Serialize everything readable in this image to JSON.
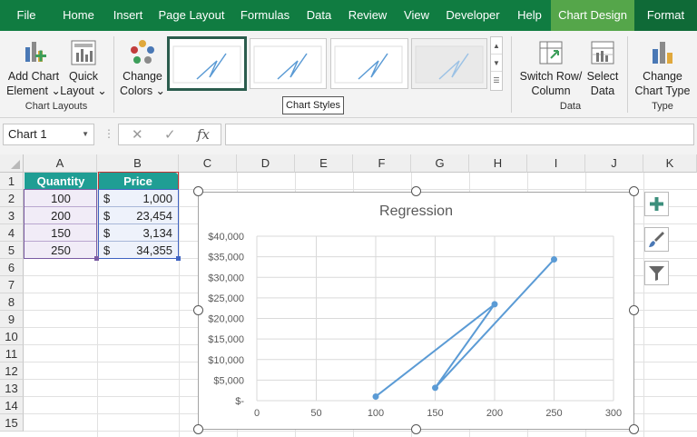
{
  "ribbon": {
    "tabs": [
      "File",
      "Home",
      "Insert",
      "Page Layout",
      "Formulas",
      "Data",
      "Review",
      "View",
      "Developer",
      "Help",
      "Chart Design",
      "Format"
    ],
    "active_tab": "Chart Design",
    "buttons": {
      "add_chart_element": [
        "Add Chart",
        "Element ⌄"
      ],
      "quick_layout": [
        "Quick",
        "Layout ⌄"
      ],
      "change_colors": [
        "Change",
        "Colors ⌄"
      ],
      "switch_row_column": [
        "Switch Row/",
        "Column"
      ],
      "select_data": [
        "Select",
        "Data"
      ],
      "change_chart_type": [
        "Change",
        "Chart Type"
      ]
    },
    "groups": {
      "chart_layouts": "Chart Layouts",
      "chart_styles": "Chart Styles",
      "data": "Data",
      "type": "Type"
    },
    "colors": {
      "tab_bar": "#107c41",
      "contextual_tab": "#55a64a"
    }
  },
  "formula_bar": {
    "name_box": "Chart 1",
    "fx_label": "fx",
    "cancel_icon": "✕",
    "enter_icon": "✓",
    "formula": ""
  },
  "sheet": {
    "columns": [
      "A",
      "B",
      "C",
      "D",
      "E",
      "F",
      "G",
      "H",
      "I",
      "J",
      "K"
    ],
    "rows": [
      "1",
      "2",
      "3",
      "4",
      "5",
      "6",
      "7",
      "8",
      "9",
      "10",
      "11",
      "12",
      "13",
      "14",
      "15"
    ],
    "table": {
      "headers": [
        "Quantity",
        "Price"
      ],
      "rows": [
        {
          "quantity": "100",
          "currency": "$",
          "price": "1,000"
        },
        {
          "quantity": "200",
          "currency": "$",
          "price": "23,454"
        },
        {
          "quantity": "150",
          "currency": "$",
          "price": "3,134"
        },
        {
          "quantity": "250",
          "currency": "$",
          "price": "34,355"
        }
      ]
    }
  },
  "chart": {
    "title": "Regression",
    "side_buttons": [
      "chart-elements-plus-icon",
      "chart-styles-brush-icon",
      "chart-filters-funnel-icon"
    ]
  },
  "chart_data": {
    "type": "scatter",
    "title": "Regression",
    "xlabel": "",
    "ylabel": "",
    "xlim": [
      0,
      300
    ],
    "ylim": [
      0,
      40000
    ],
    "x_ticks": [
      "0",
      "50",
      "100",
      "150",
      "200",
      "250",
      "300"
    ],
    "y_ticks": [
      "$-",
      "$5,000",
      "$10,000",
      "$15,000",
      "$20,000",
      "$25,000",
      "$30,000",
      "$35,000",
      "$40,000"
    ],
    "grid": true,
    "lines": true,
    "color": "#5b9bd5",
    "series": [
      {
        "x": [
          100,
          200,
          150,
          250
        ],
        "y": [
          1000,
          23454,
          3134,
          34355
        ]
      }
    ]
  }
}
